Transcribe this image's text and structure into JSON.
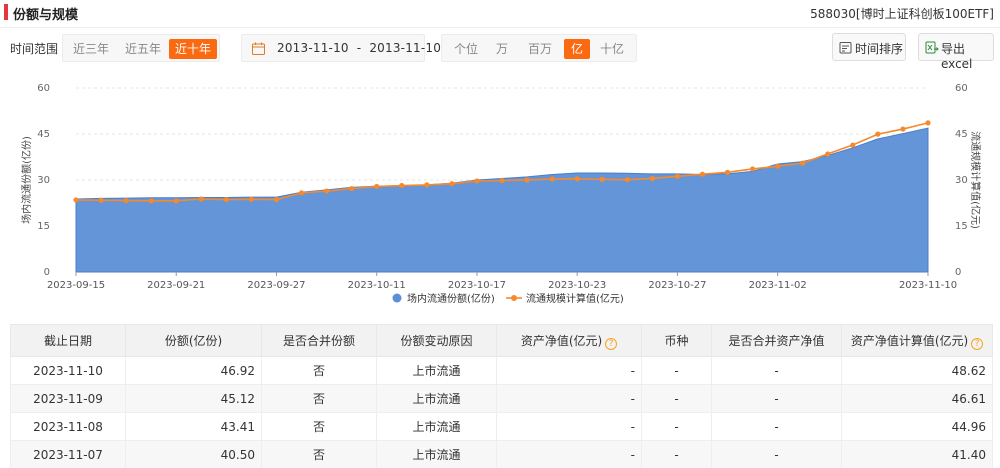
{
  "header": {
    "title": "份额与规模",
    "fund_name": "588030[博时上证科创板100ETF]"
  },
  "controls": {
    "time_range_label": "时间范围",
    "time_range_options": [
      {
        "label": "近三年",
        "active": false
      },
      {
        "label": "近五年",
        "active": false
      },
      {
        "label": "近十年",
        "active": true
      }
    ],
    "calendar_icon": "calendar-icon",
    "date_range": "2013-11-10  -  2013-11-10",
    "unit_options": [
      {
        "label": "个位",
        "active": false
      },
      {
        "label": "万",
        "active": false
      },
      {
        "label": "百万",
        "active": false
      },
      {
        "label": "亿",
        "active": true
      },
      {
        "label": "十亿",
        "active": false
      }
    ],
    "sort_button": "时间排序",
    "export_button": "导出excel",
    "sort_icon": "sort-icon",
    "export_icon": "excel-export-icon"
  },
  "chart_data": {
    "type": "area",
    "x": [
      "2023-09-15",
      "2023-09-18",
      "2023-09-19",
      "2023-09-20",
      "2023-09-21",
      "2023-09-22",
      "2023-09-25",
      "2023-09-26",
      "2023-09-27",
      "2023-09-28",
      "2023-10-09",
      "2023-10-10",
      "2023-10-11",
      "2023-10-12",
      "2023-10-13",
      "2023-10-16",
      "2023-10-17",
      "2023-10-18",
      "2023-10-19",
      "2023-10-20",
      "2023-10-23",
      "2023-10-24",
      "2023-10-25",
      "2023-10-26",
      "2023-10-27",
      "2023-10-30",
      "2023-10-31",
      "2023-11-01",
      "2023-11-02",
      "2023-11-03",
      "2023-11-06",
      "2023-11-07",
      "2023-11-08",
      "2023-11-09",
      "2023-11-10"
    ],
    "x_tick_labels": [
      "2023-09-15",
      "2023-09-21",
      "2023-09-27",
      "2023-10-11",
      "2023-10-17",
      "2023-10-23",
      "2023-10-27",
      "2023-11-02",
      "2023-11-10"
    ],
    "series": [
      {
        "name": "场内流通份额(亿份)",
        "kind": "area",
        "color": "#5b8fd6",
        "values": [
          23.8,
          24.0,
          24.1,
          24.2,
          24.2,
          24.3,
          24.3,
          24.4,
          24.4,
          26.0,
          26.8,
          27.6,
          28.0,
          28.1,
          28.4,
          29.0,
          30.0,
          30.5,
          31.0,
          31.8,
          32.3,
          32.3,
          32.2,
          32.0,
          32.0,
          31.8,
          32.0,
          32.8,
          35.2,
          36.0,
          38.0,
          40.5,
          43.41,
          45.12,
          46.92
        ]
      },
      {
        "name": "流通规模计算值(亿元)",
        "kind": "line",
        "color": "#f5892d",
        "values": [
          23.5,
          23.4,
          23.3,
          23.2,
          23.2,
          23.8,
          23.6,
          23.7,
          23.6,
          25.8,
          26.4,
          27.2,
          27.9,
          28.2,
          28.4,
          28.8,
          29.7,
          29.8,
          30.0,
          30.3,
          30.4,
          30.2,
          30.1,
          30.5,
          31.2,
          31.9,
          32.5,
          33.6,
          34.5,
          35.5,
          38.5,
          41.4,
          44.96,
          46.61,
          48.62
        ]
      }
    ],
    "ylim": [
      0,
      60
    ],
    "yticks": [
      0,
      15,
      30,
      45,
      60
    ],
    "ylabel_left": "场内流通份额(亿份)",
    "ylabel_right": "流通规模计算值(亿元)",
    "legend_position": "bottom",
    "grid": true
  },
  "table": {
    "columns": [
      {
        "label": "截止日期",
        "help": false
      },
      {
        "label": "份额(亿份)",
        "help": false
      },
      {
        "label": "是否合并份额",
        "help": false
      },
      {
        "label": "份额变动原因",
        "help": false
      },
      {
        "label": "资产净值(亿元)",
        "help": true
      },
      {
        "label": "币种",
        "help": false
      },
      {
        "label": "是否合并资产净值",
        "help": false
      },
      {
        "label": "资产净值计算值(亿元)",
        "help": true
      }
    ],
    "help_icon": "question-circle-icon",
    "rows": [
      [
        "2023-11-10",
        "46.92",
        "否",
        "上市流通",
        "-",
        "-",
        "-",
        "48.62"
      ],
      [
        "2023-11-09",
        "45.12",
        "否",
        "上市流通",
        "-",
        "-",
        "-",
        "46.61"
      ],
      [
        "2023-11-08",
        "43.41",
        "否",
        "上市流通",
        "-",
        "-",
        "-",
        "44.96"
      ],
      [
        "2023-11-07",
        "40.50",
        "否",
        "上市流通",
        "-",
        "-",
        "-",
        "41.40"
      ]
    ]
  }
}
